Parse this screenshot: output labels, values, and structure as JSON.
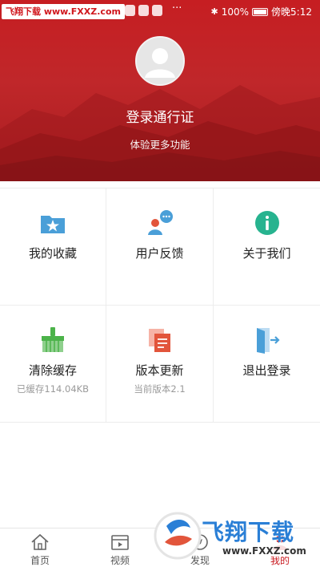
{
  "status_bar": {
    "watermark": "飞翔下载 www.FXXZ.com",
    "more": "···",
    "battery": "100%",
    "time": "傍晚5:12"
  },
  "header": {
    "login_title": "登录通行证",
    "login_subtitle": "体验更多功能"
  },
  "grid": [
    {
      "label": "我的收藏",
      "sub": "",
      "icon": "folder-star-icon"
    },
    {
      "label": "用户反馈",
      "sub": "",
      "icon": "user-chat-icon"
    },
    {
      "label": "关于我们",
      "sub": "",
      "icon": "info-icon"
    },
    {
      "label": "清除缓存",
      "sub": "已缓存114.04KB",
      "icon": "broom-icon"
    },
    {
      "label": "版本更新",
      "sub": "当前版本2.1",
      "icon": "document-copy-icon"
    },
    {
      "label": "退出登录",
      "sub": "",
      "icon": "door-exit-icon"
    }
  ],
  "tabbar": {
    "tabs": [
      {
        "label": "首页",
        "icon": "home-icon"
      },
      {
        "label": "视频",
        "icon": "video-icon"
      },
      {
        "label": "发现",
        "icon": "discover-icon"
      },
      {
        "label": "我的",
        "icon": "profile-icon"
      }
    ],
    "active_index": 3
  },
  "watermark_bottom": {
    "text": "飞翔下载",
    "url": "www.FXXZ.com"
  },
  "colors": {
    "brand_red": "#c61e22",
    "icon_blue": "#4a9fd8",
    "icon_teal": "#27b38f",
    "icon_green": "#4cb34a",
    "icon_orange": "#e2553b"
  }
}
